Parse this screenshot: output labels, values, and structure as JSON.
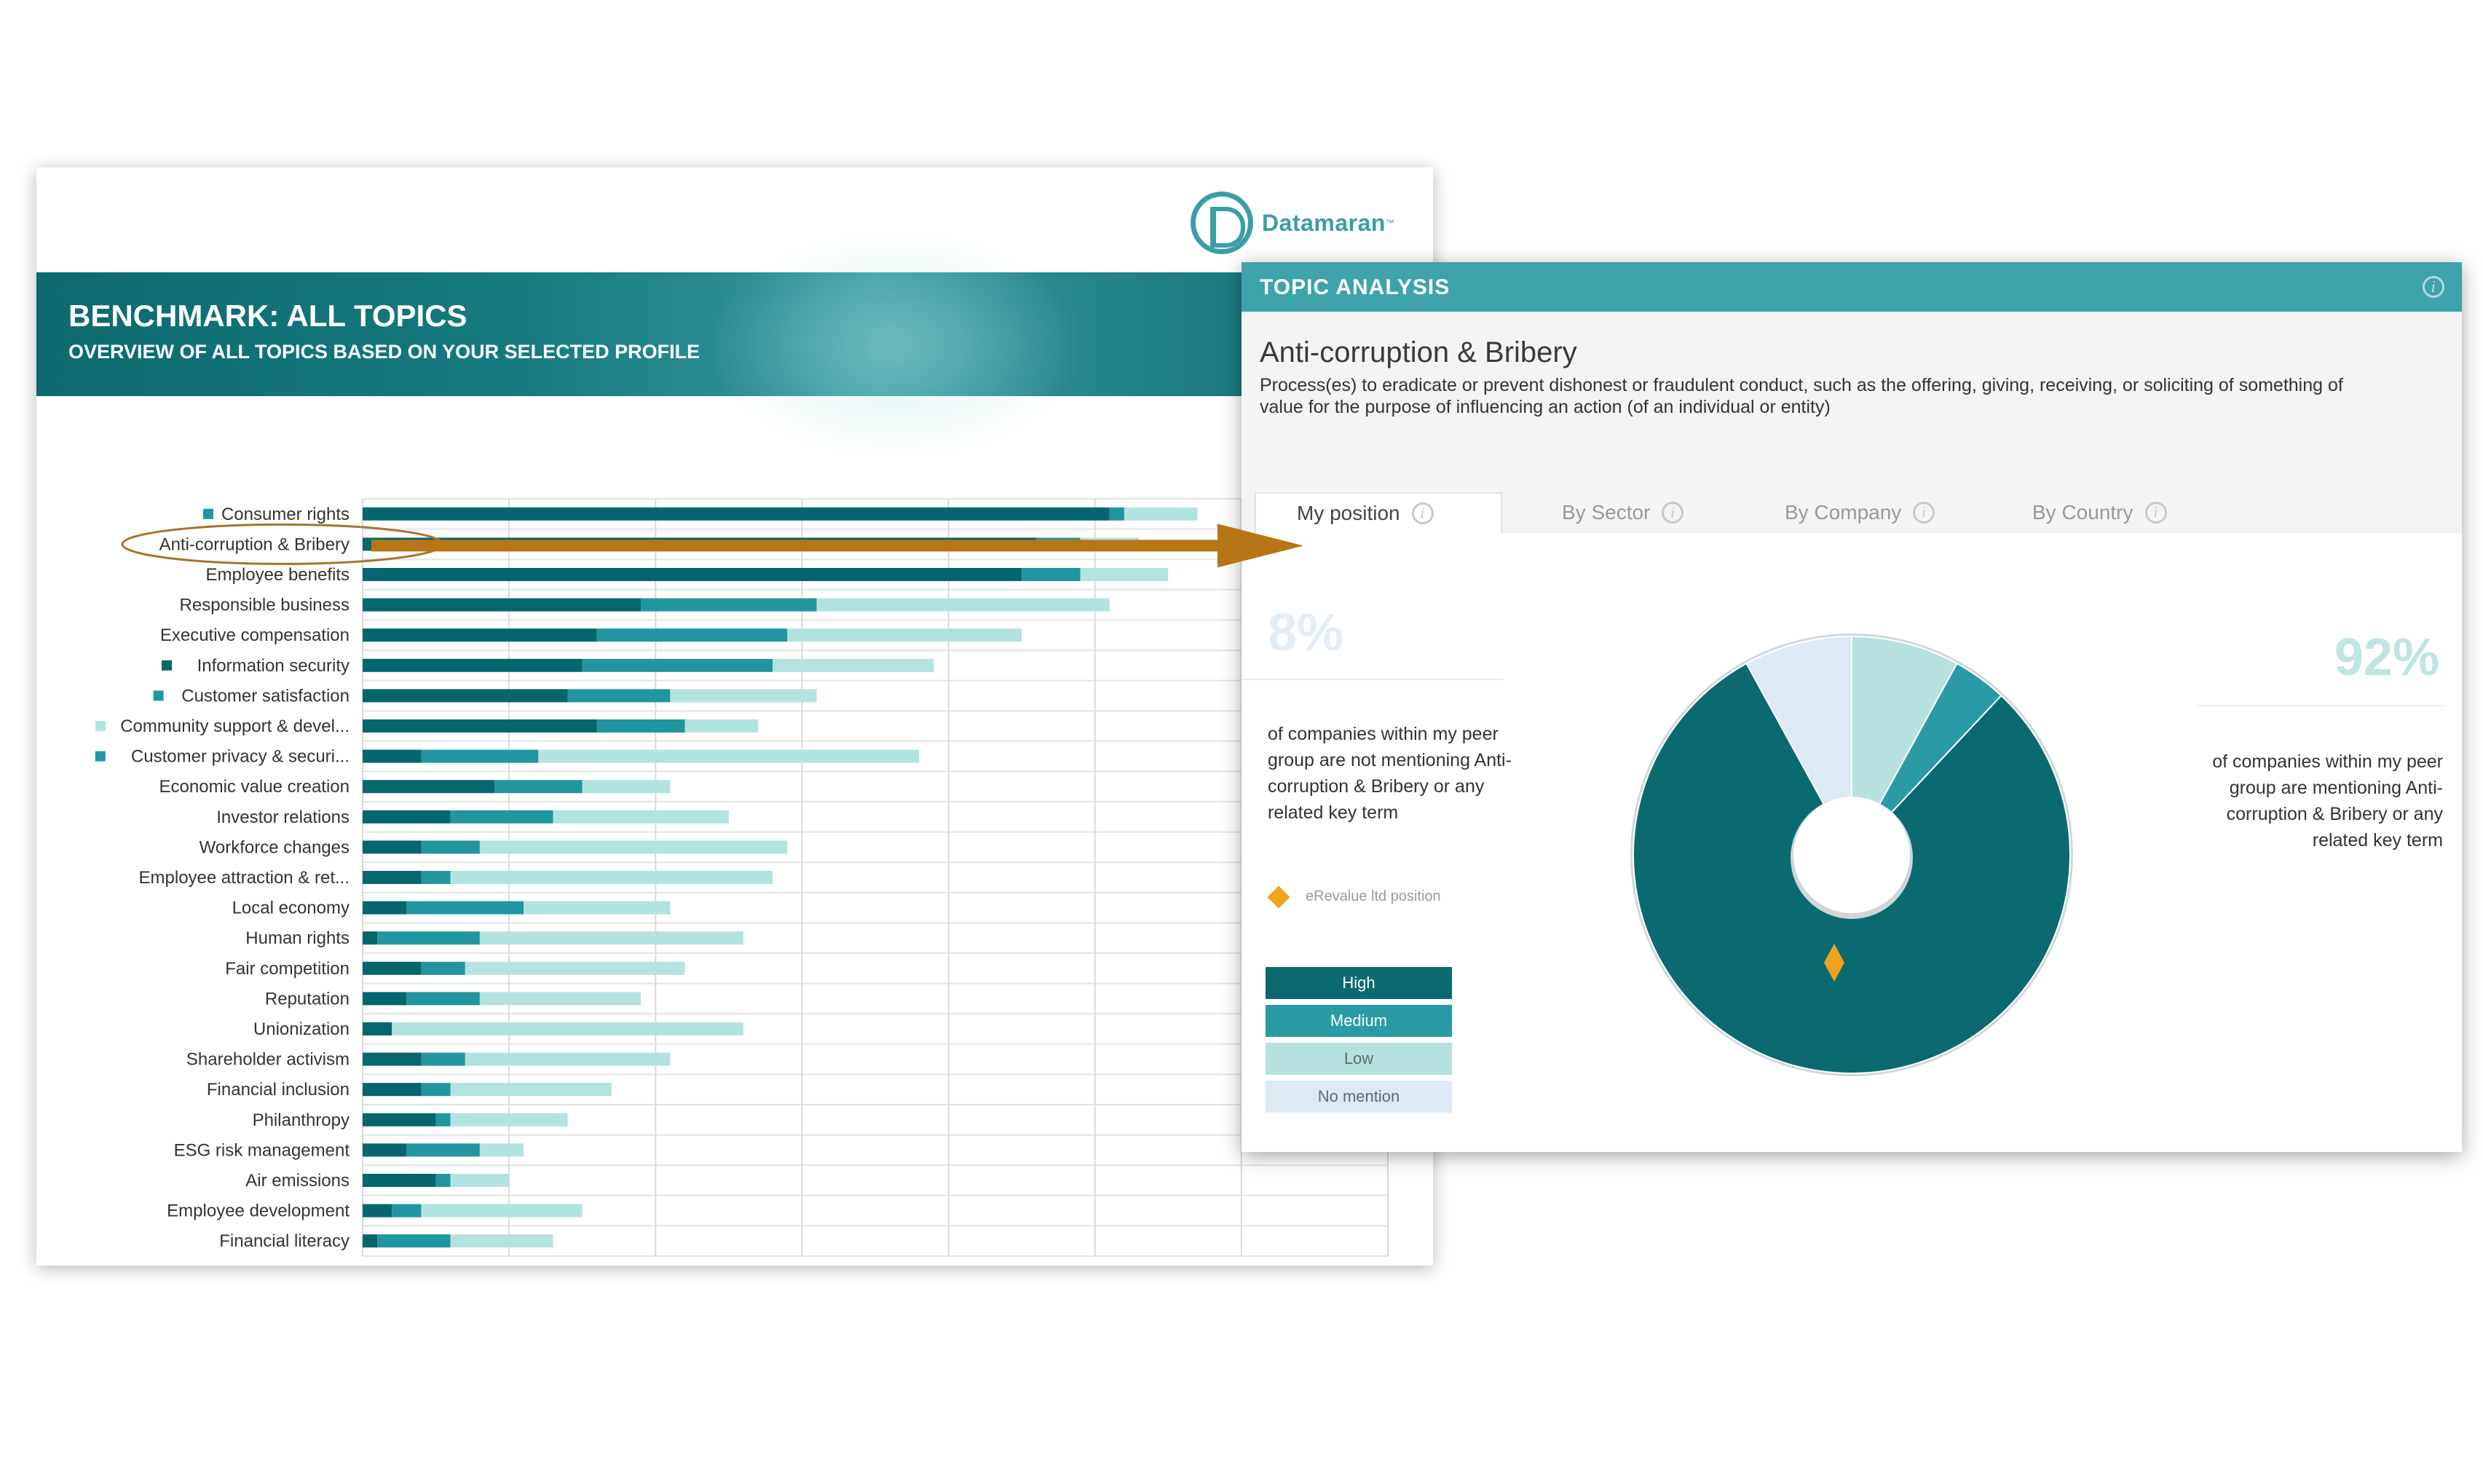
{
  "report": {
    "logo_text": "Datamaran",
    "logo_tm": "™",
    "title": "BENCHMARK: ALL TOPICS",
    "subtitle": "OVERVIEW OF ALL TOPICS BASED ON YOUR SELECTED PROFILE"
  },
  "chart_data": {
    "type": "bar",
    "orientation": "horizontal",
    "stacked": true,
    "categories": [
      "Consumer rights",
      "Anti-corruption & Bribery",
      "Employee benefits",
      "Responsible business",
      "Executive compensation",
      "Information security",
      "Customer satisfaction",
      "Community support & devel...",
      "Customer privacy & securi...",
      "Economic value creation",
      "Investor relations",
      "Workforce changes",
      "Employee attraction & ret...",
      "Local economy",
      "Human rights",
      "Fair competition",
      "Reputation",
      "Unionization",
      "Shareholder activism",
      "Financial inclusion",
      "Philanthropy",
      "ESG risk management",
      "Air emissions",
      "Employee development",
      "Financial literacy"
    ],
    "series": [
      {
        "color": "#05666d",
        "values": [
          51,
          46,
          45,
          19,
          16,
          15,
          14,
          16,
          4,
          9,
          6,
          4,
          4,
          3,
          1,
          4,
          3,
          2,
          4,
          4,
          5,
          3,
          5,
          2,
          1
        ]
      },
      {
        "color": "#2196a0",
        "values": [
          1,
          3,
          4,
          12,
          13,
          13,
          7,
          6,
          8,
          6,
          7,
          4,
          2,
          8,
          7,
          3,
          5,
          0,
          3,
          2,
          1,
          5,
          1,
          2,
          5
        ]
      },
      {
        "color": "#b3e3e0",
        "values": [
          5,
          4,
          6,
          20,
          16,
          11,
          10,
          5,
          26,
          6,
          12,
          21,
          22,
          10,
          18,
          15,
          11,
          24,
          14,
          11,
          8,
          3,
          4,
          11,
          7
        ]
      }
    ],
    "marker_colors": [
      "#2196a0",
      null,
      null,
      null,
      null,
      "#05666d",
      "#2196a0",
      "#b3e3e0",
      "#2196a0",
      null,
      null,
      null,
      null,
      null,
      null,
      null,
      null,
      null,
      null,
      null,
      null,
      null,
      null,
      null,
      null
    ],
    "highlighted": "Anti-corruption & Bribery",
    "xlim": [
      0,
      70
    ],
    "x_grid_step": 10,
    "grid": true
  },
  "topic_analysis": {
    "header": "TOPIC ANALYSIS",
    "topic": "Anti-corruption & Bribery",
    "description": "Process(es) to eradicate or prevent dishonest or fraudulent conduct, such as the offering, giving, receiving, or soliciting of something of value for the purpose of influencing an action (of an individual or entity)",
    "tabs": [
      "My position",
      "By Sector",
      "By Company",
      "By Country"
    ],
    "not_mentioning_pct": "8%",
    "not_mentioning_text": "of companies within my peer group are not mentioning Anti-corruption & Bribery or any related key term",
    "mentioning_pct": "92%",
    "mentioning_text": "of companies within my peer group are mentioning Anti-corruption & Bribery or any related key term",
    "position_label": "eRevalue ltd position",
    "legend": [
      {
        "label": "High",
        "color": "#0b6a70",
        "text_color": "#ffffff"
      },
      {
        "label": "Medium",
        "color": "#2a9ba4",
        "text_color": "#ffffff"
      },
      {
        "label": "Low",
        "color": "#b5e1df",
        "text_color": "#5d6d70"
      },
      {
        "label": "No mention",
        "color": "#dde9f5",
        "text_color": "#5d6d70"
      }
    ],
    "pie": {
      "slices": [
        {
          "label": "Low",
          "value": 8,
          "color": "#b5e1df"
        },
        {
          "label": "Medium",
          "value": 4,
          "color": "#2a9ba4"
        },
        {
          "label": "High",
          "value": 80,
          "color": "#0b6a70"
        },
        {
          "label": "No mention",
          "value": 8,
          "color": "#dde9f5"
        }
      ],
      "accent_diamond": "#f0a31c"
    }
  }
}
